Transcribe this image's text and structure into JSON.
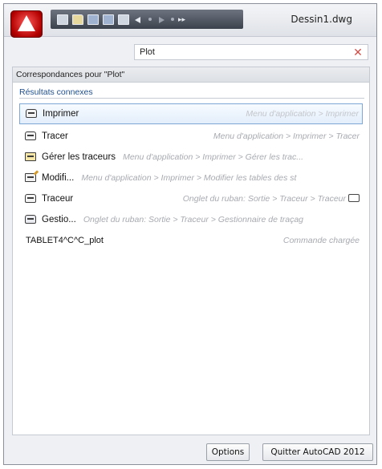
{
  "window": {
    "title": "Dessin1.dwg"
  },
  "search": {
    "value": "Plot"
  },
  "results": {
    "header": "Correspondances pour \"Plot\"",
    "section": "Résultats connexes",
    "items": [
      {
        "label": "Imprimer",
        "path": "Menu d'application > Imprimer",
        "icon": "printer-icon",
        "selected": true
      },
      {
        "label": "Tracer",
        "path": "Menu d'application > Imprimer > Tracer",
        "icon": "printer-icon"
      },
      {
        "label": "Gérer les traceurs",
        "path": "Menu d'application > Imprimer > Gérer les trac...",
        "icon": "plotter-manager-icon"
      },
      {
        "label": "Modifi...",
        "path": "Menu d'application > Imprimer > Modifier les tables des st",
        "icon": "edit-plot-style-icon"
      },
      {
        "label": "Traceur",
        "path": "Onglet du ruban: Sortie > Traceur > Traceur",
        "icon": "printer-icon"
      },
      {
        "label": "Gestio...",
        "path": "Onglet du ruban: Sortie > Traceur > Gestionnaire de traçag",
        "icon": "plotter-manager-icon"
      },
      {
        "label": "TABLET4^C^C_plot",
        "path": "Commande chargée",
        "icon": ""
      }
    ]
  },
  "footer": {
    "options_label": "Options",
    "quit_label": "Quitter AutoCAD 2012"
  }
}
